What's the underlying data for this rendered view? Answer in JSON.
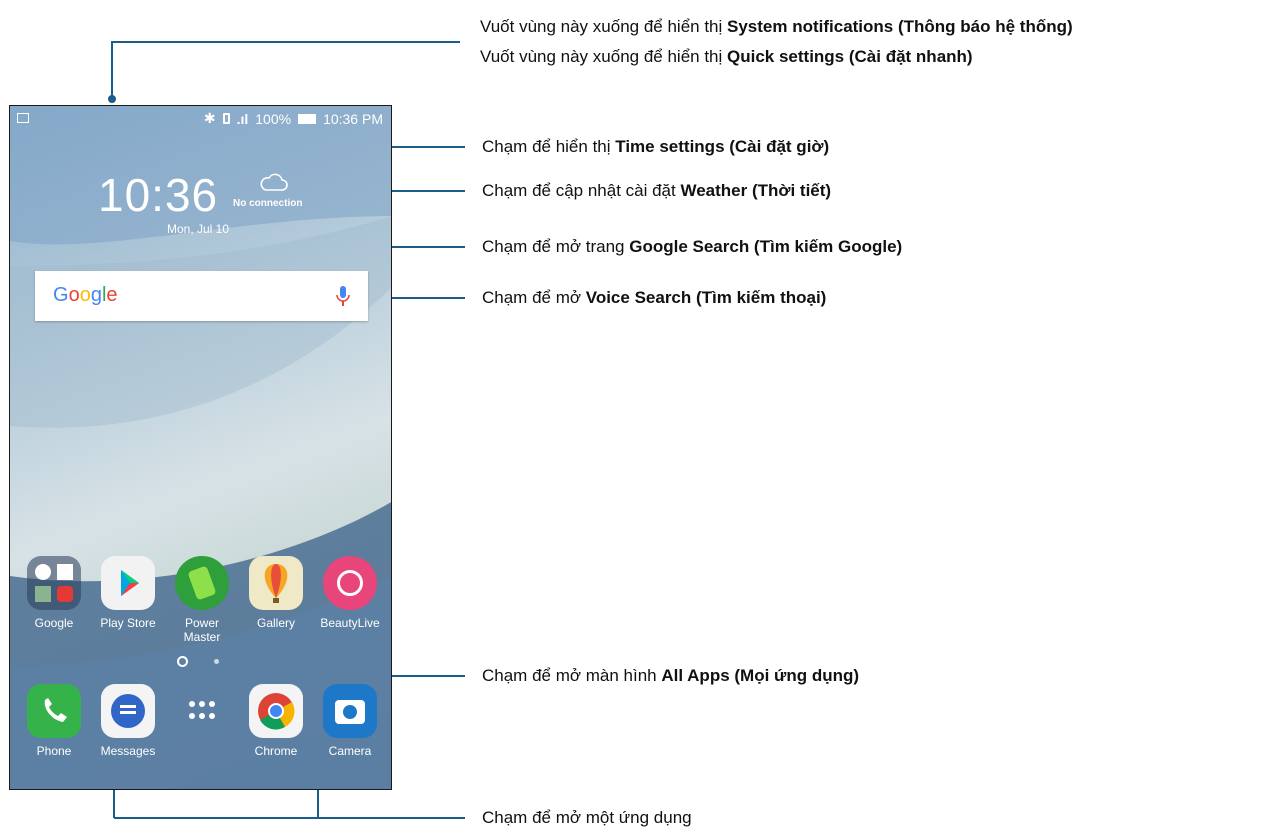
{
  "phone": {
    "status": {
      "battery": "100%",
      "time": "10:36 PM",
      "signal_bars": ".ıl"
    },
    "clock": "10:36",
    "date": "Mon, Jul 10",
    "weather": {
      "text": "No connection",
      "icon": "cloud-icon"
    },
    "search": {
      "logo": "Google",
      "mic_icon": "microphone-icon"
    },
    "apps": [
      {
        "label": "Google",
        "icon": "google-folder-icon"
      },
      {
        "label": "Play Store",
        "icon": "play-store-icon"
      },
      {
        "label": "Power\nMaster",
        "icon": "power-master-icon"
      },
      {
        "label": "Gallery",
        "icon": "gallery-icon"
      },
      {
        "label": "BeautyLive",
        "icon": "beautylive-icon"
      }
    ],
    "dock": [
      {
        "label": "Phone",
        "icon": "phone-icon"
      },
      {
        "label": "Messages",
        "icon": "messages-icon"
      },
      {
        "label": "",
        "icon": "all-apps-icon"
      },
      {
        "label": "Chrome",
        "icon": "chrome-icon"
      },
      {
        "label": "Camera",
        "icon": "camera-icon"
      }
    ]
  },
  "annotations": {
    "notif_pre": "Vuốt vùng này xuống để hiển thị ",
    "notif_bold": "System notifications (Thông báo hệ thống)",
    "quick_pre": "Vuốt vùng này xuống để hiển thị ",
    "quick_bold": "Quick settings (Cài đặt nhanh)",
    "time_pre": "Chạm để hiển thị ",
    "time_bold": "Time settings (Cài đặt giờ)",
    "weather_pre": "Chạm để cập nhật cài đặt ",
    "weather_bold": "Weather (Thời tiết)",
    "google_pre": "Chạm để mở trang ",
    "google_bold": "Google Search (Tìm kiếm Google)",
    "voice_pre": "Chạm để mở ",
    "voice_bold": "Voice Search (Tìm kiếm thoại)",
    "allapps_pre": "Chạm để mở màn hình ",
    "allapps_bold": "All Apps (Mọi ứng dụng)",
    "openapp": "Chạm để mở một ứng dụng"
  },
  "colors": {
    "line": "#1a5c8a",
    "accent_blue": "#4285f4"
  }
}
